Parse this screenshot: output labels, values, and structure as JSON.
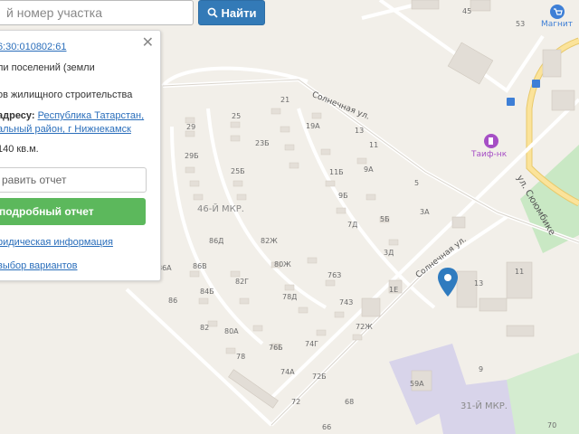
{
  "search": {
    "placeholder": "й номер участка",
    "button_label": "Найти"
  },
  "panel": {
    "cadastral_number": "6:30:010802:61",
    "category": "ли поселений (земли",
    "usage": "ов жилищного строительства",
    "address_label": "адресу:",
    "address_line1": "Республика Татарстан,",
    "address_line2": "альный район, г Нижнекамск",
    "area": "140 кв.м.",
    "report_input": "равить отчет",
    "report_button": "подробный отчет",
    "legal_link": "ридическая информация",
    "variants_link": "выбор вариантов",
    "close_label": "✕"
  },
  "map": {
    "streets": {
      "solnechnaya_1": "Солнечная ул.",
      "solnechnaya_2": "Солнечная ул.",
      "syumbike": "ул. Сююмбике"
    },
    "districts": {
      "d46": "46-Й МКР.",
      "d31": "31-Й МКР."
    },
    "pois": {
      "magnit_top": "Магнит",
      "taif": "Таиф-нк"
    },
    "house_numbers": [
      "45",
      "53",
      "21",
      "19А",
      "13",
      "11",
      "9А",
      "11Б",
      "9Б",
      "7Д",
      "5Б",
      "5",
      "3А",
      "3Д",
      "1Е",
      "29",
      "25",
      "23Б",
      "29Б",
      "25Б",
      "86Д",
      "82Ж",
      "86В",
      "80Ж",
      "76З",
      "84Б",
      "82Г",
      "78Д",
      "74З",
      "82",
      "80А",
      "76Б",
      "74Г",
      "72Ж",
      "78",
      "74А",
      "72Б",
      "72",
      "68",
      "86",
      "86А",
      "13",
      "11",
      "9",
      "59А",
      "70",
      "66"
    ]
  }
}
